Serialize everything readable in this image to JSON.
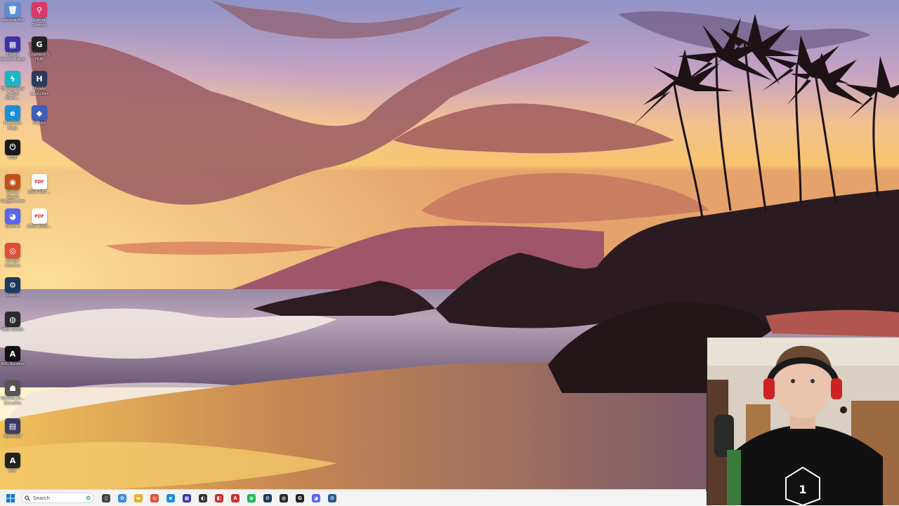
{
  "desktop": {
    "icons": [
      {
        "name": "recycle-bin-icon",
        "label": "Recycle Bin",
        "glyph": "🗑",
        "color": "#5b8fd6"
      },
      {
        "name": "lumia-stream-icon",
        "label": "Lumia Stream",
        "glyph": "⚲",
        "color": "#d93a6a"
      },
      {
        "name": "elgato-stream-deck-icon",
        "label": "Elgato Stream Deck",
        "glyph": "▦",
        "color": "#3a32a8"
      },
      {
        "name": "logitech-g-hub-icon",
        "label": "Logitech G HUB",
        "glyph": "G",
        "color": "#222222"
      },
      {
        "name": "thunderstore-icon",
        "label": "Thunderstore Mod Mana...",
        "glyph": "ϟ",
        "color": "#19b5c9"
      },
      {
        "name": "hytale-launcher-icon",
        "label": "Hytale Launcher",
        "glyph": "H",
        "color": "#2b3b5a"
      },
      {
        "name": "microsoft-edge-icon",
        "label": "Microsoft Edge",
        "glyph": "e",
        "color": "#1b8fd6"
      },
      {
        "name": "pcsx2-icon",
        "label": "PCSX2",
        "glyph": "◆",
        "color": "#3d5fb8"
      },
      {
        "name": "oqe-icon",
        "label": "OQE",
        "glyph": "⏻",
        "color": "#1a1a1a"
      },
      {
        "name": "global-speed-icon",
        "label": "Global Speed Gaggieu.exe",
        "glyph": "◉",
        "color": "#c0501a"
      },
      {
        "name": "pdf-file-1-icon",
        "label": "2024 NEC...",
        "glyph": "PDF",
        "color": "#d42b2b"
      },
      {
        "name": "discord-icon",
        "label": "Discord",
        "glyph": "◕",
        "color": "#5865f2"
      },
      {
        "name": "pdf-file-2-icon",
        "label": "2024-2025...",
        "glyph": "PDF",
        "color": "#d42b2b"
      },
      {
        "name": "google-chrome-icon",
        "label": "Google Chrome",
        "glyph": "◎",
        "color": "#e24d38"
      },
      {
        "name": "steam-icon",
        "label": "Steam",
        "glyph": "⚙",
        "color": "#1b3a5c"
      },
      {
        "name": "obs-studio-icon",
        "label": "OBS Studio",
        "glyph": "◍",
        "color": "#2a2a2a"
      },
      {
        "name": "arc-raiders-icon",
        "label": "ARC Raiders",
        "glyph": "A",
        "color": "#111111"
      },
      {
        "name": "glitch-icon",
        "label": "GLITCH_Fa... [1]-w.bin",
        "glyph": "☗",
        "color": "#555555"
      },
      {
        "name": "lastcmp-icon",
        "label": "lastcmp4",
        "glyph": "▤",
        "color": "#3a3a6a"
      },
      {
        "name": "arc-icon",
        "label": "ARC",
        "glyph": "A",
        "color": "#222222"
      }
    ]
  },
  "taskbar": {
    "search_placeholder": "Search",
    "apps": [
      {
        "name": "taskbar-file-explorer-icon",
        "glyph": "▯",
        "color": "#444444"
      },
      {
        "name": "taskbar-copilot-icon",
        "glyph": "✿",
        "color": "#3a8be0"
      },
      {
        "name": "taskbar-folder-icon",
        "glyph": "▬",
        "color": "#e6b422"
      },
      {
        "name": "taskbar-chrome-icon",
        "glyph": "◎",
        "color": "#e24d38"
      },
      {
        "name": "taskbar-edge-icon",
        "glyph": "e",
        "color": "#1b8fd6"
      },
      {
        "name": "taskbar-stream-deck-icon",
        "glyph": "▦",
        "color": "#3a32a8"
      },
      {
        "name": "taskbar-app-dark-icon",
        "glyph": "◐",
        "color": "#333333"
      },
      {
        "name": "taskbar-app-red-icon",
        "glyph": "◧",
        "color": "#c92a2a"
      },
      {
        "name": "taskbar-acrobat-icon",
        "glyph": "A",
        "color": "#d42b2b"
      },
      {
        "name": "taskbar-spotify-icon",
        "glyph": "◉",
        "color": "#1db954"
      },
      {
        "name": "taskbar-steam-icon",
        "glyph": "⚙",
        "color": "#1b3a5c"
      },
      {
        "name": "taskbar-obs-icon",
        "glyph": "◍",
        "color": "#2a2a2a"
      },
      {
        "name": "taskbar-logitech-icon",
        "glyph": "G",
        "color": "#222222"
      },
      {
        "name": "taskbar-discord-icon",
        "glyph": "◕",
        "color": "#5865f2"
      },
      {
        "name": "taskbar-steam-2-icon",
        "glyph": "⚙",
        "color": "#2a5a8a"
      }
    ]
  }
}
